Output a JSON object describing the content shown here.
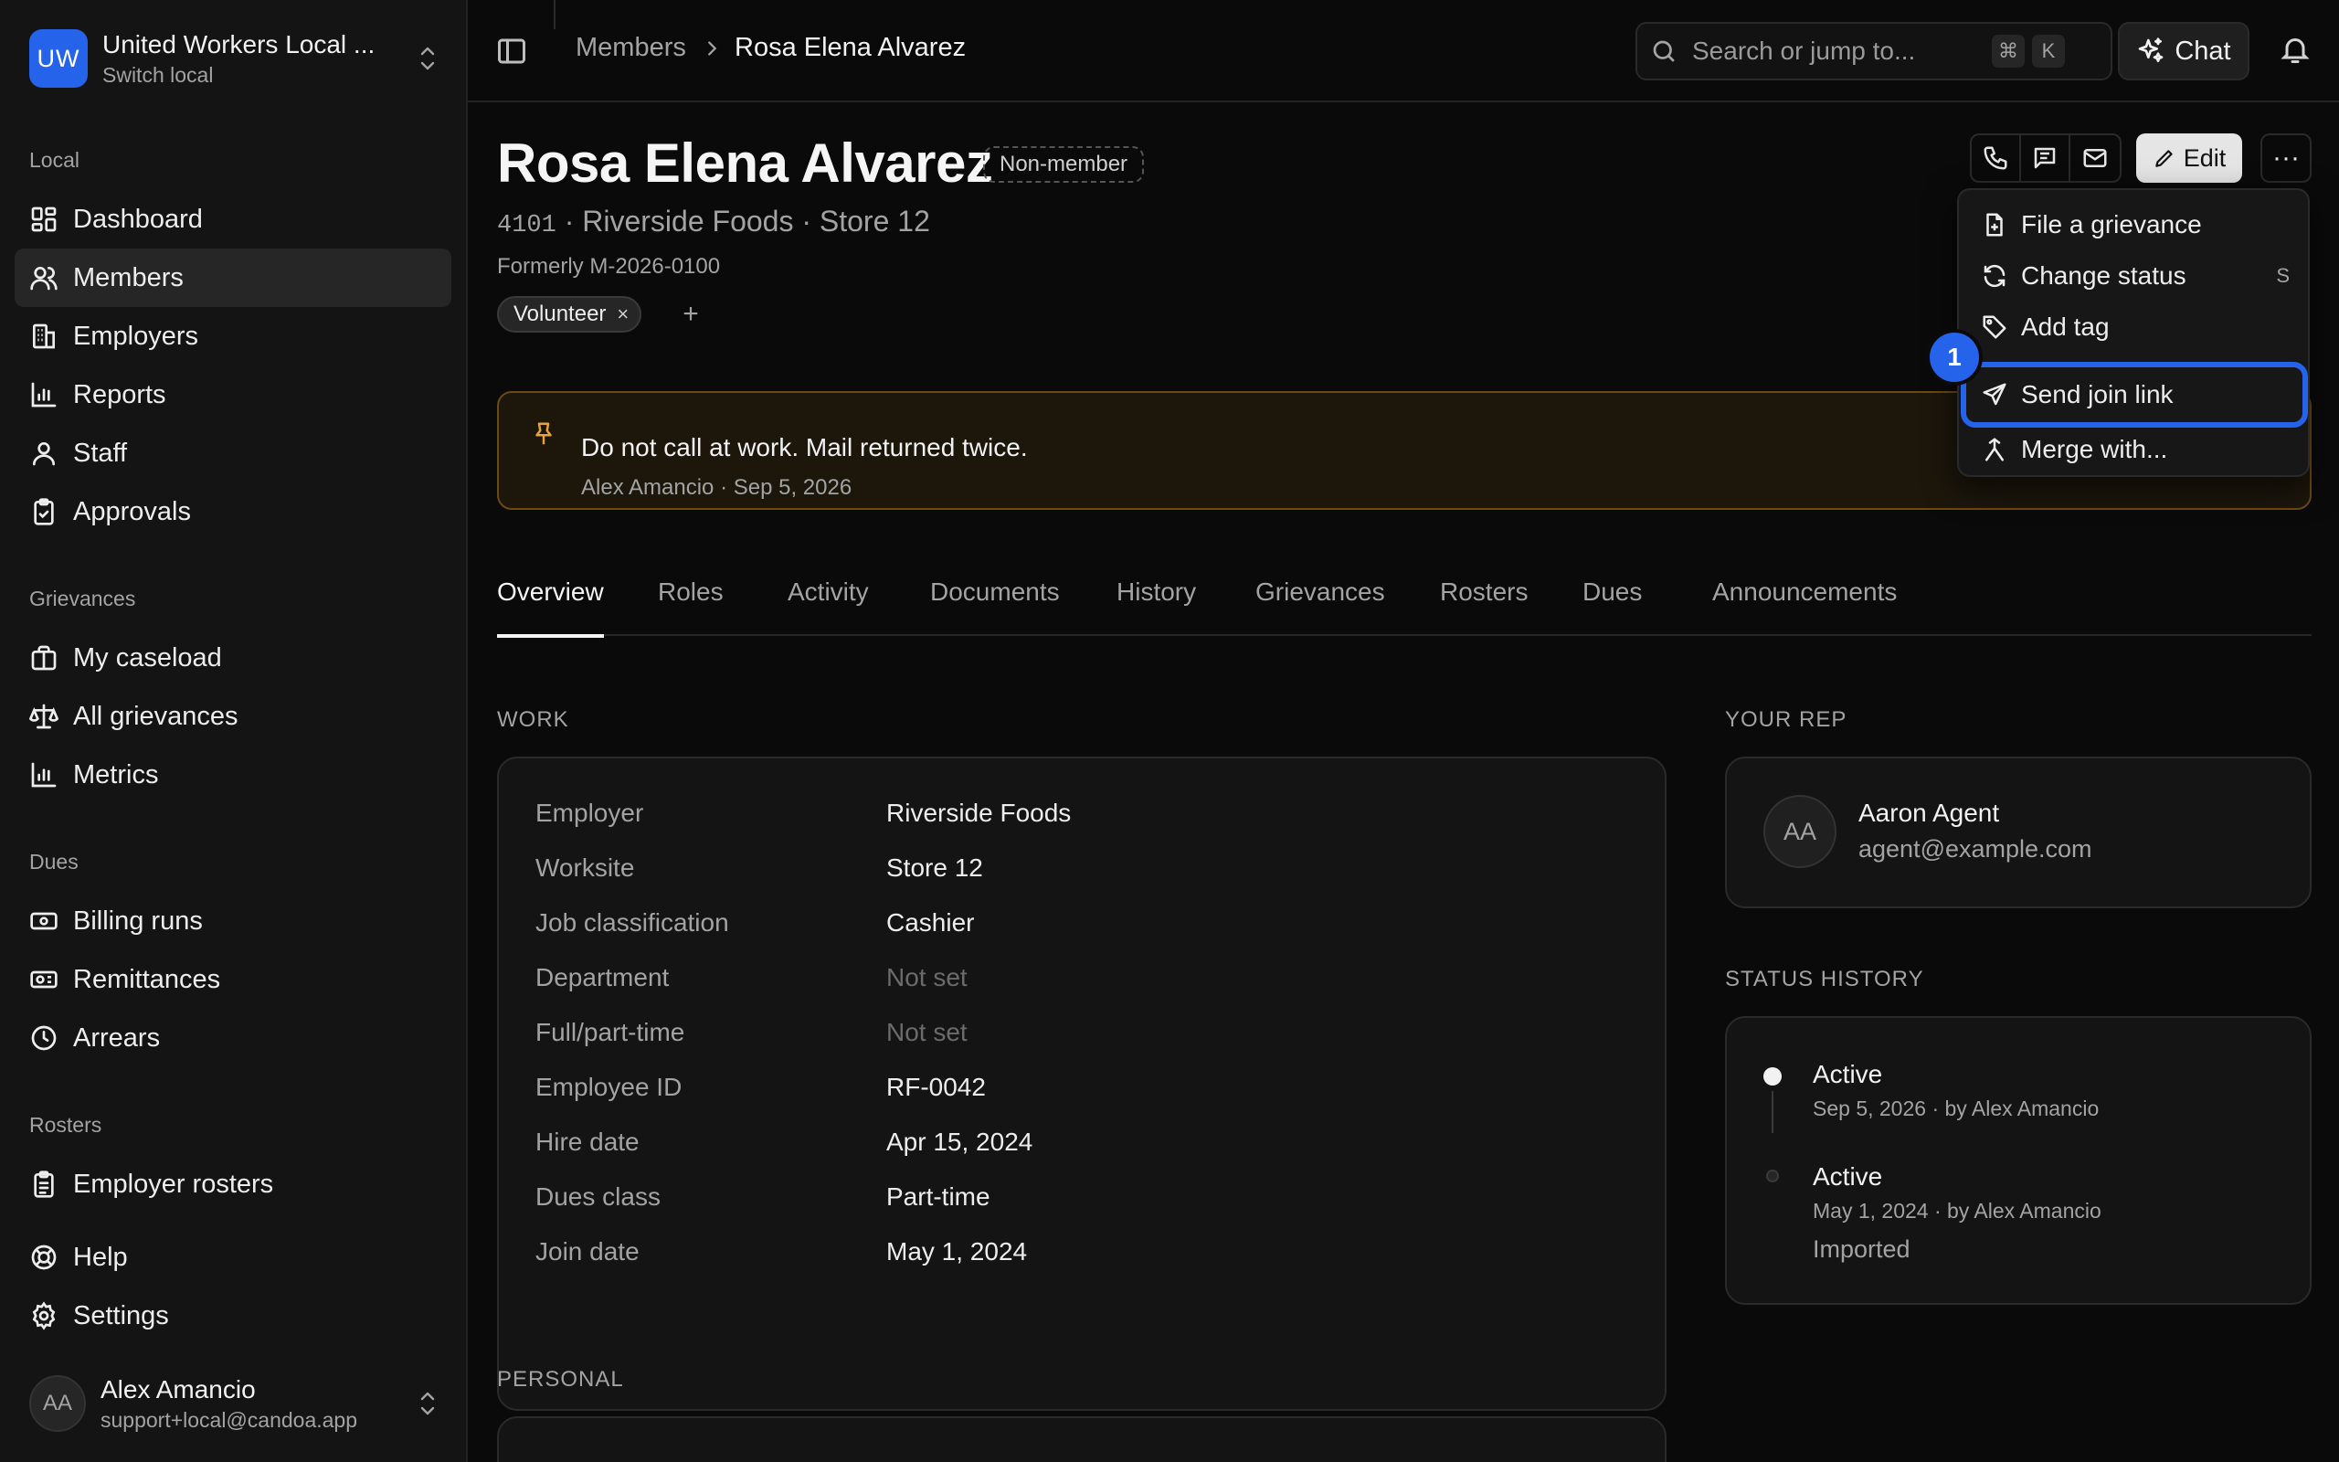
{
  "org": {
    "initials": "UW",
    "name": "United Workers Local ...",
    "subtitle": "Switch local"
  },
  "nav": {
    "sections": [
      {
        "label": "Local",
        "items": [
          {
            "label": "Dashboard",
            "icon": "dashboard-icon"
          },
          {
            "label": "Members",
            "icon": "members-icon",
            "active": true
          },
          {
            "label": "Employers",
            "icon": "building-icon"
          },
          {
            "label": "Reports",
            "icon": "bar-chart-icon"
          },
          {
            "label": "Staff",
            "icon": "user-icon"
          },
          {
            "label": "Approvals",
            "icon": "clipboard-check-icon"
          }
        ]
      },
      {
        "label": "Grievances",
        "items": [
          {
            "label": "My caseload",
            "icon": "briefcase-icon"
          },
          {
            "label": "All grievances",
            "icon": "scale-icon"
          },
          {
            "label": "Metrics",
            "icon": "bar-chart-icon"
          }
        ]
      },
      {
        "label": "Dues",
        "items": [
          {
            "label": "Billing runs",
            "icon": "banknote-icon"
          },
          {
            "label": "Remittances",
            "icon": "receipt-icon"
          },
          {
            "label": "Arrears",
            "icon": "clock-icon"
          }
        ]
      },
      {
        "label": "Rosters",
        "items": [
          {
            "label": "Employer rosters",
            "icon": "clipboard-list-icon"
          }
        ]
      }
    ],
    "bottom": [
      {
        "label": "Help",
        "icon": "lifebuoy-icon"
      },
      {
        "label": "Settings",
        "icon": "gear-icon"
      }
    ]
  },
  "user": {
    "initials": "AA",
    "name": "Alex Amancio",
    "email": "support+local@candoa.app"
  },
  "topbar": {
    "breadcrumb": [
      "Members",
      "Rosa Elena Alvarez"
    ],
    "search_placeholder": "Search or jump to...",
    "search_keys": [
      "⌘",
      "K"
    ],
    "chat_label": "Chat"
  },
  "member": {
    "name": "Rosa Elena Alvarez",
    "status_badge": "Non-member",
    "number": "4101",
    "employer": "Riverside Foods",
    "worksite": "Store 12",
    "separator": " · ",
    "formerly": "Formerly M-2026-0100",
    "tags": [
      "Volunteer"
    ],
    "tag_remove": "×",
    "tag_add": "+"
  },
  "header_actions": {
    "edit_label": "Edit",
    "more_label": "···"
  },
  "note": {
    "text": "Do not call at work. Mail returned twice.",
    "meta": "Alex Amancio · Sep 5, 2026"
  },
  "tabs": [
    "Overview",
    "Roles",
    "Activity",
    "Documents",
    "History",
    "Grievances",
    "Rosters",
    "Dues",
    "Announcements"
  ],
  "work": {
    "heading": "WORK",
    "rows": [
      {
        "label": "Employer",
        "value": "Riverside Foods"
      },
      {
        "label": "Worksite",
        "value": "Store 12"
      },
      {
        "label": "Job classification",
        "value": "Cashier"
      },
      {
        "label": "Department",
        "value": "Not set",
        "muted": true
      },
      {
        "label": "Full/part-time",
        "value": "Not set",
        "muted": true
      },
      {
        "label": "Employee ID",
        "value": "RF-0042"
      },
      {
        "label": "Hire date",
        "value": "Apr 15, 2024"
      },
      {
        "label": "Dues class",
        "value": "Part-time"
      },
      {
        "label": "Join date",
        "value": "May 1, 2024"
      }
    ]
  },
  "personal": {
    "heading": "PERSONAL"
  },
  "rep": {
    "heading": "YOUR REP",
    "initials": "AA",
    "name": "Aaron Agent",
    "email": "agent@example.com"
  },
  "status_history": {
    "heading": "STATUS HISTORY",
    "entries": [
      {
        "status": "Active",
        "meta": "Sep 5, 2026 · by Alex Amancio",
        "note": ""
      },
      {
        "status": "Active",
        "meta": "May 1, 2024 · by Alex Amancio",
        "note": "Imported"
      }
    ]
  },
  "menu": {
    "items": [
      {
        "label": "File a grievance",
        "icon": "file-plus-icon",
        "shortcut": ""
      },
      {
        "label": "Change status",
        "icon": "refresh-icon",
        "shortcut": "S"
      },
      {
        "label": "Add tag",
        "icon": "tag-icon",
        "shortcut": ""
      },
      {
        "label": "Send join link",
        "icon": "send-icon",
        "shortcut": "",
        "highlighted": true
      },
      {
        "label": "Merge with...",
        "icon": "merge-icon",
        "shortcut": ""
      }
    ],
    "step_number": "1"
  },
  "colors": {
    "accent": "#2563eb",
    "warning_border": "#6b4a12",
    "warning_icon": "#e6a23c"
  }
}
